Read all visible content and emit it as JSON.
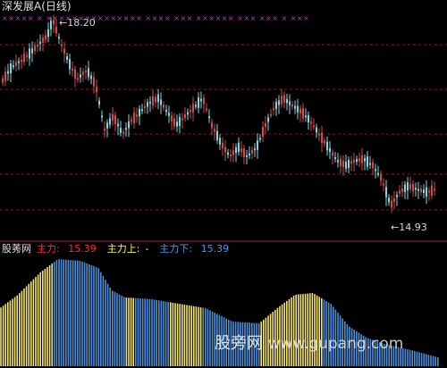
{
  "title": "深发展A(日线)",
  "price_panel": {
    "high_marker": "18.20",
    "low_marker": "14.93",
    "marker_row": "××××× × ××××××××××××××× ×××× ××× ×××××× ××× ××× × ×××"
  },
  "indicator_panel": {
    "name": "股莠网",
    "main_label": "主力:",
    "main_value": "15.39",
    "up_label": "主力上:",
    "up_value": "-",
    "down_label": "主力下:",
    "down_value": "15.39"
  },
  "watermark": {
    "cn": "股旁网",
    "url": "www.gupang.com"
  },
  "colors": {
    "background": "#000000",
    "up_candle": "#d24a4a",
    "down_candle": "#7fd6e0",
    "marker": "#cc33cc",
    "grid": "#8a1a1a",
    "main_label": "#ff3030",
    "up_label": "#ffff40",
    "down_label": "#3c9bff",
    "bar_yellow": "#f5e66e",
    "bar_blue": "#4a8fdc"
  },
  "chart_data": [
    {
      "type": "candlestick",
      "title": "深发展A(日线)",
      "y_high": 18.2,
      "y_low": 14.93
    },
    {
      "type": "bar",
      "series": [
        {
          "name": "主力",
          "last": 15.39
        }
      ],
      "segments": [
        "yellow",
        "blue",
        "yellow",
        "blue",
        "yellow",
        "blue",
        "yellow",
        "blue"
      ]
    }
  ]
}
